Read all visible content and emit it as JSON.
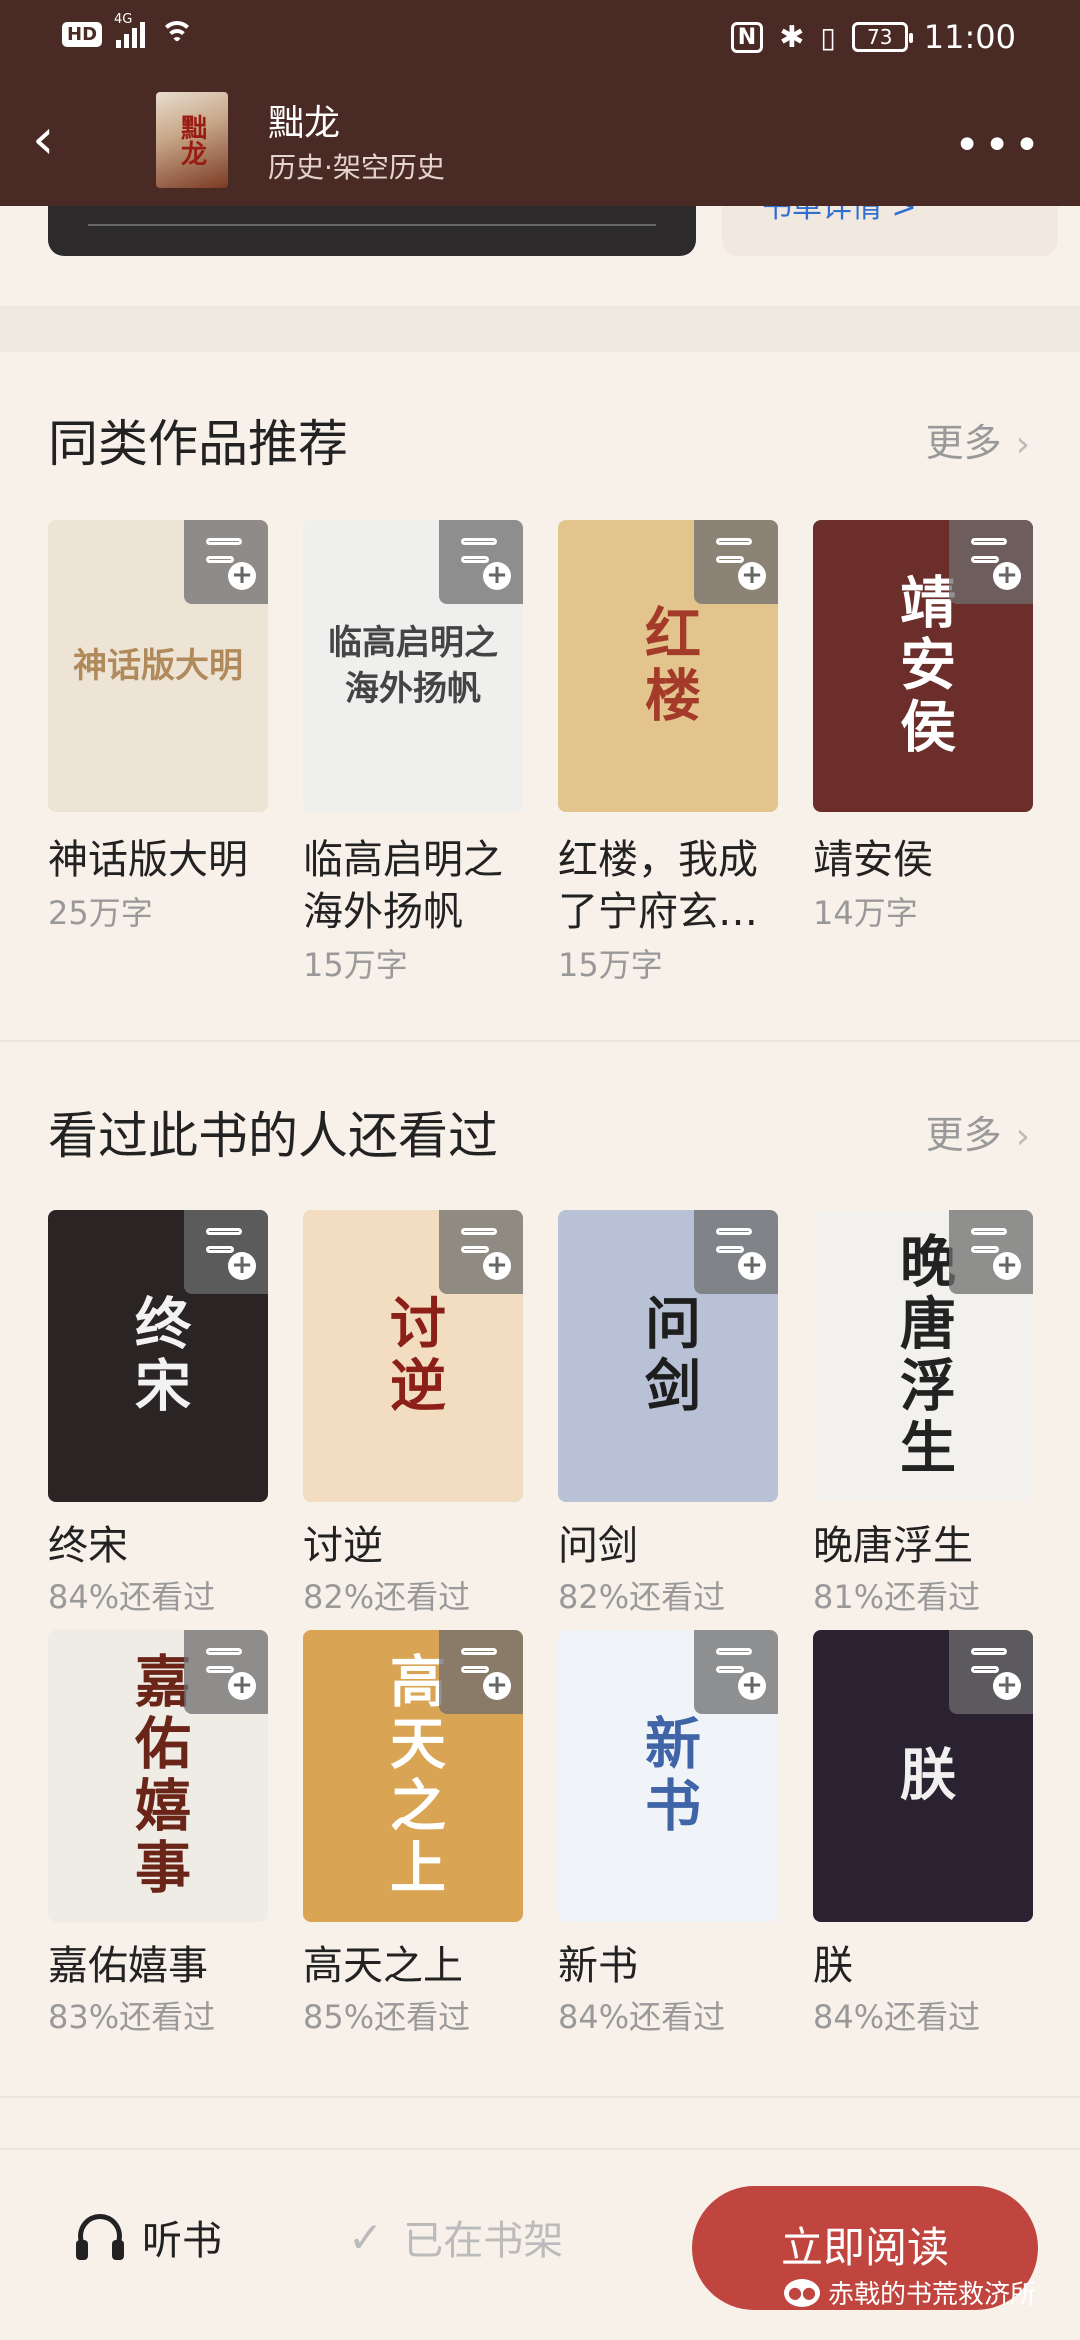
{
  "status": {
    "network": "4G",
    "hd": "HD",
    "battery": "73",
    "time": "11:00",
    "nfc": "N"
  },
  "header": {
    "title": "黜龙",
    "category": "历史·架空历史",
    "cover_text": "黜龙"
  },
  "peek": {
    "detail_link": "书单详情 >"
  },
  "similar": {
    "title": "同类作品推荐",
    "more": "更多",
    "books": [
      {
        "title": "神话版大明",
        "sub": "25万字",
        "cover_text": "神话版大明",
        "bg": "#ede4d6",
        "fg": "#b08a5a"
      },
      {
        "title": "临高启明之海外扬帆",
        "sub": "15万字",
        "cover_text": "临高启明之海外扬帆",
        "bg": "#efefed",
        "fg": "#444444"
      },
      {
        "title": "红楼，我成了宁府玄…",
        "sub": "15万字",
        "cover_text": "红楼",
        "bg": "#e2c48c",
        "fg": "#a33a2a"
      },
      {
        "title": "靖安侯",
        "sub": "14万字",
        "cover_text": "靖安侯",
        "bg": "#6b2e2a",
        "fg": "#ffffff"
      }
    ]
  },
  "alsoread": {
    "title": "看过此书的人还看过",
    "more": "更多",
    "books": [
      {
        "title": "终宋",
        "sub": "84%还看过",
        "cover_text": "终宋",
        "bg": "#2a2524",
        "fg": "#f2f2f2"
      },
      {
        "title": "讨逆",
        "sub": "82%还看过",
        "cover_text": "讨逆",
        "bg": "#f2ddc0",
        "fg": "#8c1f17"
      },
      {
        "title": "问剑",
        "sub": "82%还看过",
        "cover_text": "问剑",
        "bg": "#b9c1d6",
        "fg": "#1e1e1e"
      },
      {
        "title": "晚唐浮生",
        "sub": "81%还看过",
        "cover_text": "晚唐浮生",
        "bg": "#f3f1ee",
        "fg": "#222222"
      },
      {
        "title": "嘉佑嬉事",
        "sub": "83%还看过",
        "cover_text": "嘉佑嬉事",
        "bg": "#efece6",
        "fg": "#6a2418"
      },
      {
        "title": "高天之上",
        "sub": "85%还看过",
        "cover_text": "高天之上",
        "bg": "#d9a453",
        "fg": "#ffffff"
      },
      {
        "title": "新书",
        "sub": "84%还看过",
        "cover_text": "新书",
        "bg": "#f0f3f7",
        "fg": "#3f64a8"
      },
      {
        "title": "朕",
        "sub": "84%还看过",
        "cover_text": "朕",
        "bg": "#2a2230",
        "fg": "#f0f0f0"
      }
    ]
  },
  "bottom": {
    "listen": "听书",
    "shelf": "已在书架",
    "read": "立即阅读",
    "watermark": "赤戟的书荒救济所"
  }
}
